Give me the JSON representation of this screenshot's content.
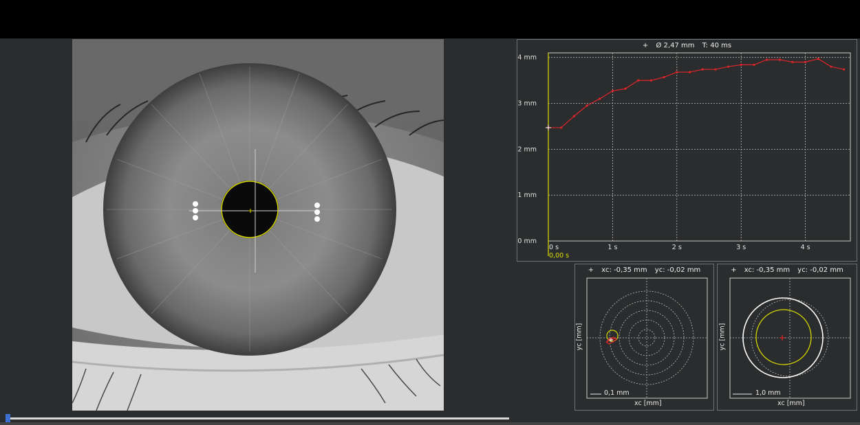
{
  "pupil_chart": {
    "header_icon": "crosshair-icon",
    "header_diameter": "Ø 2,47 mm",
    "header_time": "T: 40 ms",
    "y_tick_labels": [
      "4 mm",
      "3 mm",
      "2 mm",
      "1 mm",
      "0 mm"
    ],
    "x_tick_labels": [
      "0 s",
      "1 s",
      "2 s",
      "3 s",
      "4 s"
    ],
    "cursor_time": "0,00 s",
    "line_color": "#e0262b",
    "cursor_color": "#e0e000"
  },
  "chart_data": {
    "type": "line",
    "title": "",
    "xlabel": "",
    "ylabel": "",
    "xlim": [
      0,
      4.7
    ],
    "ylim": [
      0,
      4.1
    ],
    "grid": true,
    "x_unit": "s",
    "y_unit": "mm",
    "series": [
      {
        "x": [
          0.0,
          0.2,
          0.4,
          0.6,
          0.8,
          1.0,
          1.2,
          1.4,
          1.6,
          1.8,
          2.0,
          2.2,
          2.4,
          2.6,
          2.8,
          3.0,
          3.2,
          3.4,
          3.6,
          3.8,
          4.0,
          4.2,
          4.4,
          4.6
        ],
        "y": [
          2.47,
          2.47,
          2.72,
          2.95,
          3.1,
          3.27,
          3.32,
          3.5,
          3.5,
          3.57,
          3.68,
          3.68,
          3.74,
          3.74,
          3.8,
          3.84,
          3.84,
          3.95,
          3.95,
          3.9,
          3.9,
          3.97,
          3.8,
          3.74
        ]
      }
    ]
  },
  "centroid_plot_small": {
    "header_icon": "crosshair-icon",
    "xc_label": "xc: -0,35 mm",
    "yc_label": "yc: -0,02 mm",
    "scale_label": "0,1 mm",
    "x_axis_label": "xc [mm]",
    "y_axis_label": "yc [mm]"
  },
  "centroid_plot_large": {
    "header_icon": "crosshair-icon",
    "xc_label": "xc: -0,35 mm",
    "yc_label": "yc: -0,02 mm",
    "scale_label": "1,0 mm",
    "x_axis_label": "xc [mm]",
    "y_axis_label": "yc [mm]"
  },
  "playback": {
    "progress": 0.0
  }
}
